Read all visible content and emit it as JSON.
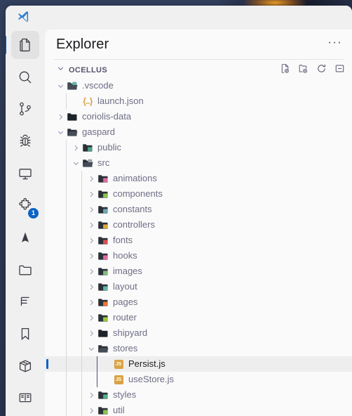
{
  "desktop": {
    "name": "desktop-wallpaper"
  },
  "window": {
    "app": "visual-studio-code"
  },
  "titlebar": {
    "logo_icon": "vscode-logo"
  },
  "activity_bar": {
    "items": [
      {
        "name": "explorer",
        "icon": "files-icon",
        "active": true,
        "badge": ""
      },
      {
        "name": "search",
        "icon": "search-icon",
        "active": false,
        "badge": ""
      },
      {
        "name": "source-control",
        "icon": "source-control-icon",
        "active": false,
        "badge": ""
      },
      {
        "name": "run-and-debug",
        "icon": "debug-icon",
        "active": false,
        "badge": ""
      },
      {
        "name": "remote-explorer",
        "icon": "remote-monitor-icon",
        "active": false,
        "badge": ""
      },
      {
        "name": "extensions",
        "icon": "extensions-puzzle-icon",
        "active": false,
        "badge": "1"
      },
      {
        "name": "vitest",
        "icon": "mountain-icon",
        "active": false,
        "badge": ""
      },
      {
        "name": "project-manager",
        "icon": "folder-icon",
        "active": false,
        "badge": ""
      },
      {
        "name": "outline",
        "icon": "list-outline-icon",
        "active": false,
        "badge": ""
      },
      {
        "name": "bookmarks",
        "icon": "bookmark-icon",
        "active": false,
        "badge": ""
      },
      {
        "name": "package-explorer",
        "icon": "package-box-icon",
        "active": false,
        "badge": ""
      },
      {
        "name": "documentation",
        "icon": "open-book-icon",
        "active": false,
        "badge": ""
      }
    ]
  },
  "explorer": {
    "title": "Explorer",
    "more_label": "···",
    "root": {
      "label": "OCELLUS",
      "expanded": true,
      "actions": [
        {
          "name": "new-file-button",
          "icon": "new-file-icon"
        },
        {
          "name": "new-folder-button",
          "icon": "new-folder-icon"
        },
        {
          "name": "refresh-explorer-button",
          "icon": "refresh-icon"
        },
        {
          "name": "collapse-folders-button",
          "icon": "collapse-all-icon"
        }
      ]
    },
    "tree": [
      {
        "label": ".vscode",
        "depth": 1,
        "type": "folder",
        "state": "expanded",
        "icon": "folder-vscode-icon",
        "color": "#3f4a52",
        "accent": "#5fb8a8",
        "selected": false
      },
      {
        "label": "launch.json",
        "depth": 2,
        "type": "json",
        "state": "none",
        "icon": "json-file-icon",
        "color": "#d2a24c",
        "accent": "#d2a24c",
        "selected": false
      },
      {
        "label": "coriolis-data",
        "depth": 1,
        "type": "folder",
        "state": "collapsed",
        "icon": "folder-plain-icon",
        "color": "#1e232a",
        "accent": "#1e232a",
        "selected": false
      },
      {
        "label": "gaspard",
        "depth": 1,
        "type": "folder",
        "state": "expanded",
        "icon": "folder-open-icon",
        "color": "#2b3138",
        "accent": "#2b3138",
        "selected": false
      },
      {
        "label": "public",
        "depth": 2,
        "type": "folder",
        "state": "collapsed",
        "icon": "folder-public-icon",
        "color": "#2b3138",
        "accent": "#4da08c",
        "selected": false
      },
      {
        "label": "src",
        "depth": 2,
        "type": "folder",
        "state": "expanded",
        "icon": "folder-src-open-icon",
        "color": "#2b3138",
        "accent": "#9aa4ad",
        "selected": false
      },
      {
        "label": "animations",
        "depth": 3,
        "type": "folder",
        "state": "collapsed",
        "icon": "folder-animations-icon",
        "color": "#2b3138",
        "accent": "#e06c9f",
        "selected": false
      },
      {
        "label": "components",
        "depth": 3,
        "type": "folder",
        "state": "collapsed",
        "icon": "folder-components-icon",
        "color": "#2b3138",
        "accent": "#8bc34a",
        "selected": false
      },
      {
        "label": "constants",
        "depth": 3,
        "type": "folder",
        "state": "collapsed",
        "icon": "folder-constants-icon",
        "color": "#2b3138",
        "accent": "#6fa8b5",
        "selected": false
      },
      {
        "label": "controllers",
        "depth": 3,
        "type": "folder",
        "state": "collapsed",
        "icon": "folder-controllers-icon",
        "color": "#2b3138",
        "accent": "#e0a83a",
        "selected": false
      },
      {
        "label": "fonts",
        "depth": 3,
        "type": "folder",
        "state": "collapsed",
        "icon": "folder-fonts-icon",
        "color": "#2b3138",
        "accent": "#d94f4f",
        "selected": false
      },
      {
        "label": "hooks",
        "depth": 3,
        "type": "folder",
        "state": "collapsed",
        "icon": "folder-hooks-icon",
        "color": "#2b3138",
        "accent": "#e06c9f",
        "selected": false
      },
      {
        "label": "images",
        "depth": 3,
        "type": "folder",
        "state": "collapsed",
        "icon": "folder-images-icon",
        "color": "#2b3138",
        "accent": "#7ec07a",
        "selected": false
      },
      {
        "label": "layout",
        "depth": 3,
        "type": "folder",
        "state": "collapsed",
        "icon": "folder-layout-icon",
        "color": "#2b3138",
        "accent": "#5fb8a8",
        "selected": false
      },
      {
        "label": "pages",
        "depth": 3,
        "type": "folder",
        "state": "collapsed",
        "icon": "folder-pages-icon",
        "color": "#2b3138",
        "accent": "#e8763a",
        "selected": false
      },
      {
        "label": "router",
        "depth": 3,
        "type": "folder",
        "state": "collapsed",
        "icon": "folder-router-icon",
        "color": "#2b3138",
        "accent": "#9acd32",
        "selected": false
      },
      {
        "label": "shipyard",
        "depth": 3,
        "type": "folder",
        "state": "collapsed",
        "icon": "folder-plain-icon",
        "color": "#1e232a",
        "accent": "#1e232a",
        "selected": false
      },
      {
        "label": "stores",
        "depth": 3,
        "type": "folder",
        "state": "expanded",
        "icon": "folder-open-icon",
        "color": "#2b3138",
        "accent": "#2b3138",
        "selected": false
      },
      {
        "label": "Persist.js",
        "depth": 4,
        "type": "js",
        "state": "none",
        "icon": "javascript-file-icon",
        "color": "#d9a343",
        "accent": "#d9a343",
        "selected": true
      },
      {
        "label": "useStore.js",
        "depth": 4,
        "type": "js",
        "state": "none",
        "icon": "javascript-file-icon",
        "color": "#d9a343",
        "accent": "#d9a343",
        "selected": false
      },
      {
        "label": "styles",
        "depth": 3,
        "type": "folder",
        "state": "collapsed",
        "icon": "folder-styles-icon",
        "color": "#2b3138",
        "accent": "#4fb08a",
        "selected": false
      },
      {
        "label": "util",
        "depth": 3,
        "type": "folder",
        "state": "collapsed",
        "icon": "folder-util-icon",
        "color": "#2b3138",
        "accent": "#8bc34a",
        "selected": false
      }
    ]
  },
  "colors": {
    "accent_blue": "#0a62c9",
    "panel_bg": "#fafafa",
    "activitybar_bg": "#f0f0f0",
    "selected_row_bg": "#eeeeee",
    "tree_text": "#6e6e86",
    "root_text": "#54546f",
    "active_guide": "#4d4d73"
  }
}
